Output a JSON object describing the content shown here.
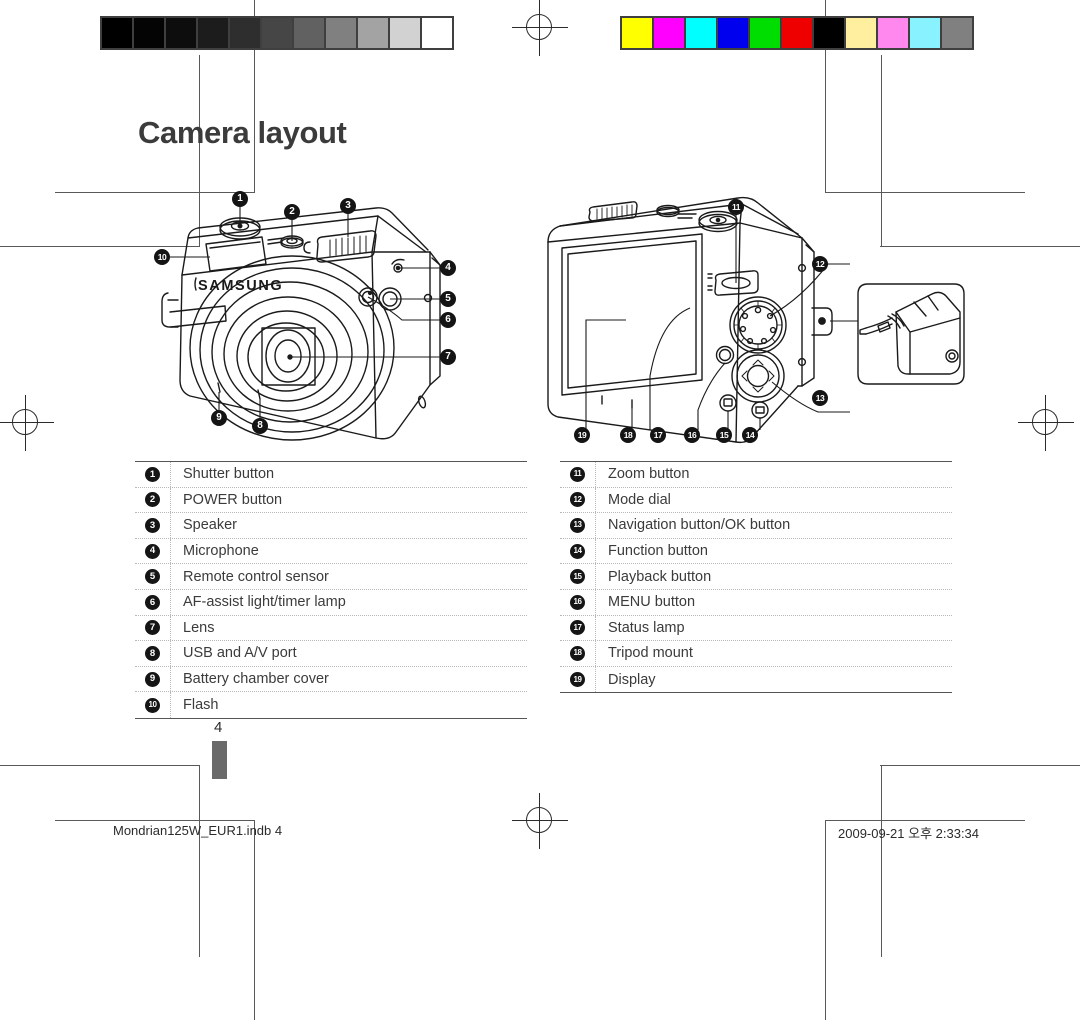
{
  "page": {
    "title": "Camera layout",
    "page_number": "4",
    "footer_left": "Mondrian125W_EUR1.indb   4",
    "footer_right": "2009-09-21   오후 2:33:34"
  },
  "calibration": {
    "gray_bar": {
      "name": "grayscale-calibration-bar",
      "swatches": [
        "#000000",
        "#040404",
        "#0d0d0d",
        "#1c1c1c",
        "#2e2e2e",
        "#464646",
        "#616161",
        "#808080",
        "#a3a3a3",
        "#d2d2d2",
        "#ffffff"
      ]
    },
    "color_bar": {
      "name": "color-calibration-bar",
      "swatches": [
        "#ffff00",
        "#ff00ff",
        "#00ffff",
        "#0000ee",
        "#00dd00",
        "#ee0000",
        "#000000",
        "#ffef9e",
        "#ff88ee",
        "#88f3ff",
        "#808080"
      ]
    }
  },
  "figures": {
    "front": {
      "name": "camera-front-view",
      "brand_text": "SAMSUNG",
      "callouts": [
        "1",
        "2",
        "3",
        "4",
        "5",
        "6",
        "7",
        "8",
        "9",
        "10"
      ]
    },
    "rear": {
      "name": "camera-rear-view",
      "callouts": [
        "11",
        "12",
        "13",
        "14",
        "15",
        "16",
        "17",
        "18",
        "19"
      ],
      "inset_name": "strap-attachment-detail"
    }
  },
  "legend_left": {
    "rows": [
      {
        "num": "1",
        "label": "Shutter button"
      },
      {
        "num": "2",
        "label": "POWER button"
      },
      {
        "num": "3",
        "label": "Speaker"
      },
      {
        "num": "4",
        "label": "Microphone"
      },
      {
        "num": "5",
        "label": "Remote control sensor"
      },
      {
        "num": "6",
        "label": "AF-assist light/timer lamp"
      },
      {
        "num": "7",
        "label": "Lens"
      },
      {
        "num": "8",
        "label": "USB and A/V port"
      },
      {
        "num": "9",
        "label": "Battery chamber cover"
      },
      {
        "num": "10",
        "label": "Flash"
      }
    ]
  },
  "legend_right": {
    "rows": [
      {
        "num": "11",
        "label": "Zoom button"
      },
      {
        "num": "12",
        "label": "Mode dial"
      },
      {
        "num": "13",
        "label": "Navigation button/OK button"
      },
      {
        "num": "14",
        "label": "Function button"
      },
      {
        "num": "15",
        "label": "Playback button"
      },
      {
        "num": "16",
        "label": "MENU button"
      },
      {
        "num": "17",
        "label": "Status lamp"
      },
      {
        "num": "18",
        "label": "Tripod mount"
      },
      {
        "num": "19",
        "label": "Display"
      }
    ]
  }
}
